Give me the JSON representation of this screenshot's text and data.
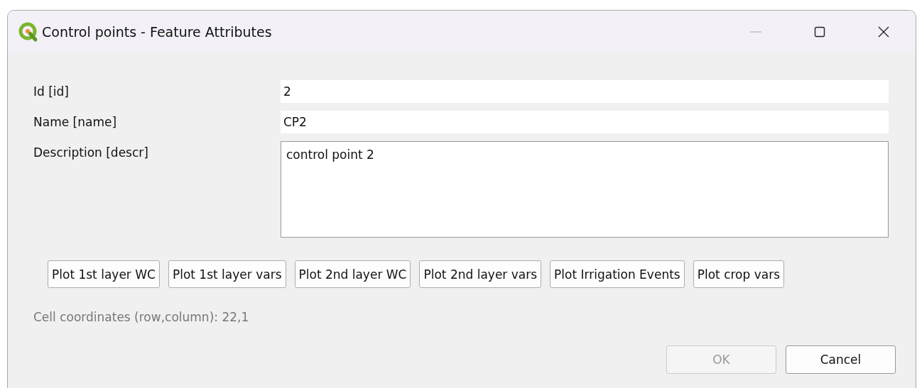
{
  "window": {
    "title": "Control points - Feature Attributes",
    "minimize_disabled": true
  },
  "fields": [
    {
      "label": "Id [id]",
      "value": "2",
      "kind": "line"
    },
    {
      "label": "Name [name]",
      "value": "CP2",
      "kind": "line"
    },
    {
      "label": "Description [descr]",
      "value": "control point 2",
      "kind": "multiline"
    }
  ],
  "plot_buttons": [
    "Plot 1st layer WC",
    "Plot 1st layer vars",
    "Plot 2nd layer WC",
    "Plot 2nd layer vars",
    "Plot Irrigation Events",
    "Plot crop vars"
  ],
  "status_text": "Cell coordinates (row,column): 22,1",
  "dialog_buttons": [
    {
      "label": "OK",
      "disabled": true
    },
    {
      "label": "Cancel",
      "disabled": false
    }
  ]
}
